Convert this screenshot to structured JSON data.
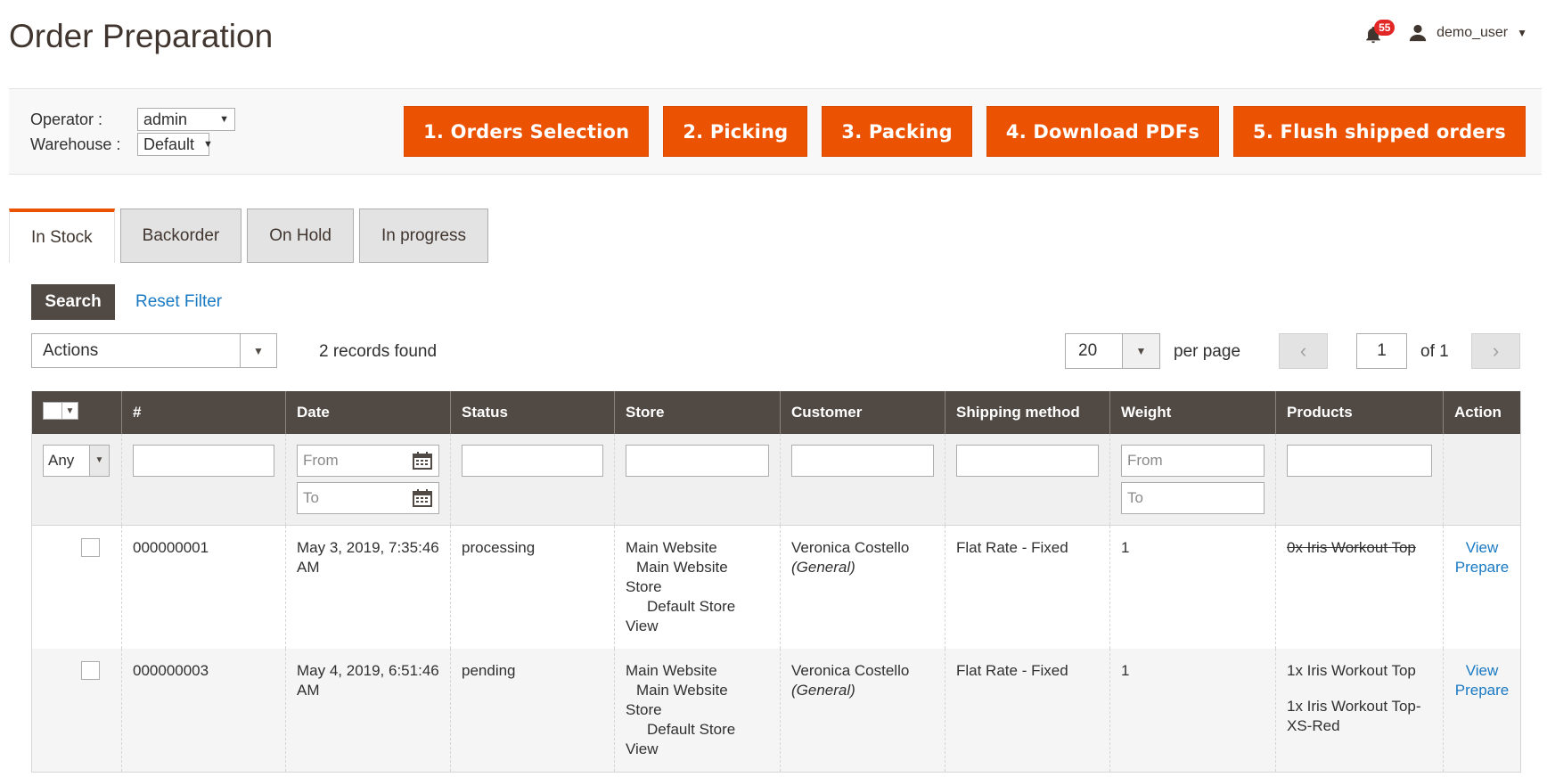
{
  "page": {
    "title": "Order Preparation"
  },
  "header": {
    "notifications_count": "55",
    "username": "demo_user"
  },
  "toolbar": {
    "operator_label": "Operator :",
    "operator_value": "admin",
    "warehouse_label": "Warehouse :",
    "warehouse_value": "Default",
    "steps": [
      "1. Orders Selection",
      "2. Picking",
      "3. Packing",
      "4. Download PDFs",
      "5. Flush shipped orders"
    ]
  },
  "tabs": [
    "In Stock",
    "Backorder",
    "On Hold",
    "In progress"
  ],
  "active_tab": "In Stock",
  "search": {
    "search_label": "Search",
    "reset_label": "Reset Filter"
  },
  "grid_controls": {
    "actions_label": "Actions",
    "records_found": "2 records found",
    "per_page_value": "20",
    "per_page_label": "per page",
    "current_page": "1",
    "of_pages": "of 1"
  },
  "columns": [
    "#",
    "Date",
    "Status",
    "Store",
    "Customer",
    "Shipping method",
    "Weight",
    "Products",
    "Action"
  ],
  "filters": {
    "any_label": "Any",
    "date_from": "From",
    "date_to": "To",
    "weight_from": "From",
    "weight_to": "To"
  },
  "rows": [
    {
      "id": "000000001",
      "date": "May 3, 2019, 7:35:46 AM",
      "status": "processing",
      "store": {
        "website": "Main Website",
        "store_line1": "Main Website",
        "store_line2": "Store",
        "view_line1": "Default Store",
        "view_line2": "View"
      },
      "customer": "Veronica Costello",
      "customer_group": "(General)",
      "shipping": "Flat Rate - Fixed",
      "weight": "1",
      "products": [
        "0x Iris Workout Top"
      ],
      "action_view": "View",
      "action_prepare": "Prepare"
    },
    {
      "id": "000000003",
      "date": "May 4, 2019, 6:51:46 AM",
      "status": "pending",
      "store": {
        "website": "Main Website",
        "store_line1": "Main Website",
        "store_line2": "Store",
        "view_line1": "Default Store",
        "view_line2": "View"
      },
      "customer": "Veronica Costello",
      "customer_group": "(General)",
      "shipping": "Flat Rate - Fixed",
      "weight": "1",
      "products": [
        "1x Iris Workout Top",
        "1x Iris Workout Top-XS-Red"
      ],
      "action_view": "View",
      "action_prepare": "Prepare"
    }
  ],
  "colors": {
    "accent": "#eb5202",
    "header_bg": "#514943",
    "link": "#1979c3"
  }
}
